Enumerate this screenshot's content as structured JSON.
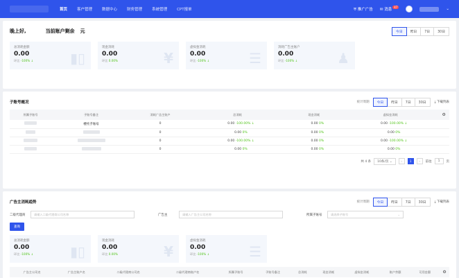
{
  "topbar": {
    "nav": [
      {
        "label": "首页",
        "active": true
      },
      {
        "label": "客户管理",
        "active": false
      },
      {
        "label": "数据中心",
        "active": false
      },
      {
        "label": "财务管理",
        "active": false
      },
      {
        "label": "系统管理",
        "active": false
      },
      {
        "label": "CPT报单",
        "active": false
      }
    ],
    "ad_platform": "推广广告",
    "messages": "消息",
    "message_count": "47"
  },
  "summary": {
    "greeting": "晚上好,",
    "balance_label": "当前账户剩余",
    "balance_unit": "元",
    "periods": [
      "今日",
      "昨日",
      "7日",
      "30日"
    ],
    "stats": [
      {
        "label": "总消耗金额",
        "value": "0.00",
        "cmp_label": "环比",
        "pct": "-100%"
      },
      {
        "label": "现金消耗",
        "value": "0.00",
        "cmp_label": "环比",
        "pct": "0.00%"
      },
      {
        "label": "虚拟金消耗",
        "value": "0.00",
        "cmp_label": "环比",
        "pct": "-100%"
      },
      {
        "label": "消耗广告主账户",
        "value": "0.00",
        "cmp_label": "环比",
        "pct": "-100%"
      }
    ]
  },
  "subaccounts": {
    "title": "子账号概况",
    "period_label": "统计周期",
    "periods": [
      "今日",
      "昨日",
      "7日",
      "30日"
    ],
    "download": "下载列表",
    "columns": [
      "所属子账号",
      "子账号备注",
      "消耗广告主账户",
      "总消耗",
      "现金消耗",
      "虚拟金消耗"
    ],
    "rows": [
      {
        "remark": "楼托子账号",
        "count": "0",
        "total": "0.00",
        "total_pct": "-100.00%",
        "cash": "0.00",
        "cash_pct": "0%",
        "virtual": "0.00",
        "virtual_pct": "-100.00%"
      },
      {
        "remark": "",
        "count": "0",
        "total": "0.00",
        "total_pct": "0%",
        "cash": "0.00",
        "cash_pct": "0%",
        "virtual": "0.00",
        "virtual_pct": "0%"
      },
      {
        "remark": "",
        "count": "0",
        "total": "0.00",
        "total_pct": "-100.00%",
        "cash": "0.00",
        "cash_pct": "0%",
        "virtual": "0.00",
        "virtual_pct": "-100.00%"
      },
      {
        "remark": "",
        "count": "0",
        "total": "0.00",
        "total_pct": "0%",
        "cash": "0.00",
        "cash_pct": "0%",
        "virtual": "0.00",
        "virtual_pct": "0%"
      }
    ],
    "pager": {
      "total": "共 4 条",
      "page_size": "10条/页",
      "current": "1",
      "goto_label": "前往",
      "goto_value": "1",
      "page_unit": "页"
    }
  },
  "trend": {
    "title": "广告主消耗趋势",
    "period_label": "统计周期",
    "periods": [
      "今日",
      "昨日",
      "7日",
      "30日"
    ],
    "download": "下载列表",
    "filters": [
      {
        "label": "二级代理商",
        "placeholder": "请输入二级代理商公司名称"
      },
      {
        "label": "广告主",
        "placeholder": "请输入广告主公司名称"
      },
      {
        "label": "所属子账号",
        "placeholder": "请选择子账号"
      }
    ],
    "query": "查询",
    "stats": [
      {
        "label": "总消耗金额",
        "value": "0.00",
        "cmp_label": "环比",
        "pct": "-100%"
      },
      {
        "label": "现金消耗",
        "value": "0.00",
        "cmp_label": "环比",
        "pct": "0.00%"
      },
      {
        "label": "虚拟金消耗",
        "value": "0.00",
        "cmp_label": "环比",
        "pct": "-100%"
      }
    ],
    "columns": [
      "广告主公司名",
      "广告主账户名",
      "二级代理商公司名",
      "二级代理商账户名",
      "所属子账号",
      "子账号备注",
      "总消耗",
      "现金消耗",
      "虚拟金消耗",
      "账户余额",
      "可用金额",
      "可以余额"
    ]
  }
}
